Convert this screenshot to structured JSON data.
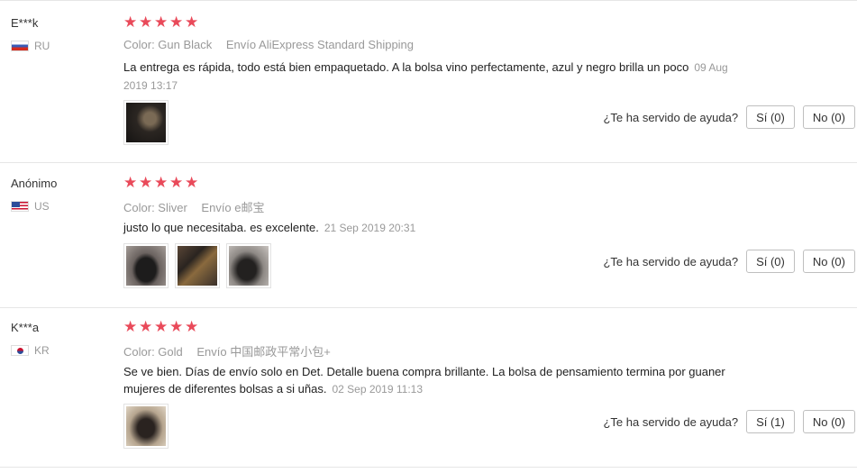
{
  "helpful_question": "¿Te ha servido de ayuda?",
  "reviews": [
    {
      "user": "E***k",
      "country": "RU",
      "rating": 5,
      "color": "Color: Gun Black",
      "shipping": "Envío AliExpress Standard Shipping",
      "text": "La entrega es rápida, todo está bien empaquetado. A la bolsa vino perfectamente, azul y negro brilla un poco",
      "date": "09 Aug 2019 13:17",
      "photo_count": 1,
      "yes_label": "Sí (0)",
      "no_label": "No (0)"
    },
    {
      "user": "Anónimo",
      "country": "US",
      "rating": 5,
      "color": "Color: Sliver",
      "shipping": "Envío e邮宝",
      "text": "justo lo que necesitaba. es excelente.",
      "date": "21 Sep 2019 20:31",
      "photo_count": 3,
      "yes_label": "Sí (0)",
      "no_label": "No (0)"
    },
    {
      "user": "K***a",
      "country": "KR",
      "rating": 5,
      "color": "Color: Gold",
      "shipping": "Envío 中国邮政平常小包+",
      "text": "Se ve bien. Días de envío solo en Det. Detalle buena compra brillante. La bolsa de pensamiento termina por guaner mujeres de diferentes bolsas a si uñas.",
      "date": "02 Sep 2019 11:13",
      "photo_count": 1,
      "yes_label": "Sí (1)",
      "no_label": "No (0)"
    }
  ]
}
